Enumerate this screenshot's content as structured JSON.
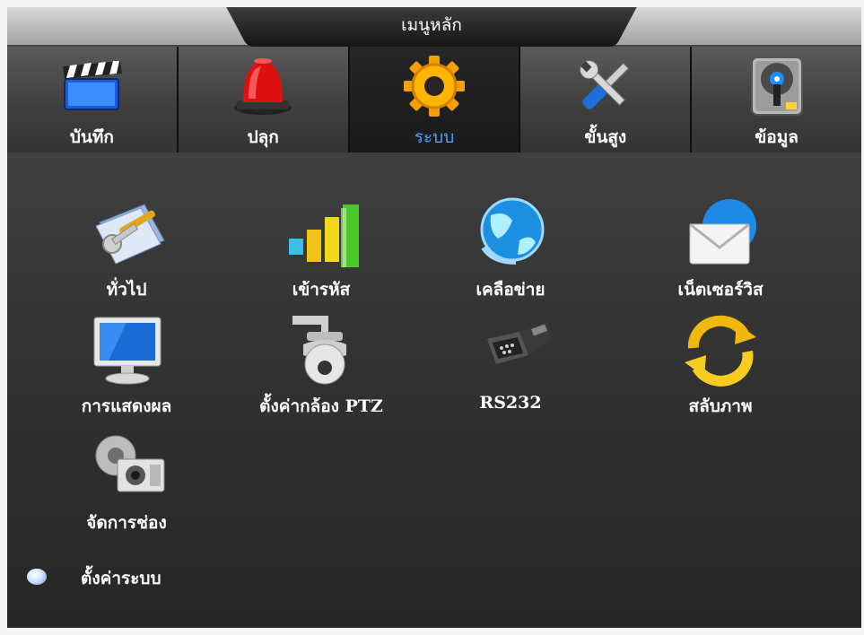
{
  "window": {
    "title": "เมนูหลัก"
  },
  "tabs": [
    {
      "label": "บันทึก",
      "icon": "clapperboard-icon"
    },
    {
      "label": "ปลุก",
      "icon": "alarm-siren-icon"
    },
    {
      "label": "ระบบ",
      "icon": "gear-icon",
      "active": true
    },
    {
      "label": "ขั้นสูง",
      "icon": "tools-icon"
    },
    {
      "label": "ข้อมูล",
      "icon": "hard-disk-icon"
    }
  ],
  "items": [
    {
      "label": "ทั่วไป",
      "icon": "general-settings-icon"
    },
    {
      "label": "เข้ารหัส",
      "icon": "encode-bars-icon"
    },
    {
      "label": "เคลือข่าย",
      "icon": "network-globe-icon"
    },
    {
      "label": "เน็ตเซอร์วิส",
      "icon": "net-service-mail-icon"
    },
    {
      "label": "การแสดงผล",
      "icon": "monitor-icon"
    },
    {
      "label": "ตั้งค่ากล้อง PTZ",
      "icon": "ptz-camera-icon"
    },
    {
      "label": "RS232",
      "icon": "serial-port-icon"
    },
    {
      "label": "สลับภาพ",
      "icon": "swap-arrows-icon"
    },
    {
      "label": "จัดการช่อง",
      "icon": "channel-manage-icon"
    }
  ],
  "footer": {
    "label": "ตั้งค่าระบบ",
    "icon": "bullet-icon"
  },
  "colors": {
    "active_tab_text": "#4da0ff",
    "text": "#ffffff"
  }
}
